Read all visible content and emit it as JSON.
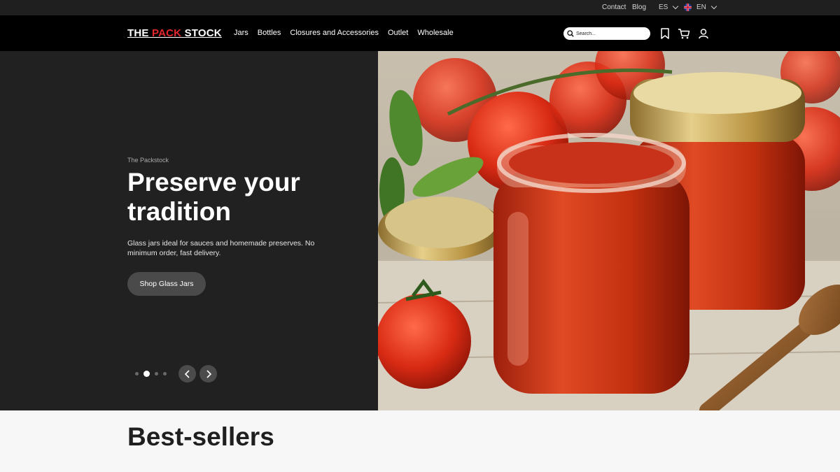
{
  "topbar": {
    "contact": "Contact",
    "blog": "Blog",
    "lang_es": "ES",
    "lang_en": "EN"
  },
  "header": {
    "logo_part1": "THE",
    "logo_part2": "PACK",
    "logo_part3": "STOCK",
    "nav": [
      "Jars",
      "Bottles",
      "Closures and Accessories",
      "Outlet",
      "Wholesale"
    ],
    "search_placeholder": "Search...",
    "icons": [
      "search-icon",
      "bookmark-icon",
      "cart-icon",
      "user-icon"
    ]
  },
  "hero": {
    "eyebrow": "The Packstock",
    "headline": "Preserve your tradition",
    "description": "Glass jars ideal for sauces and homemade preserves. No minimum order, fast delivery.",
    "cta_label": "Shop Glass Jars",
    "slides_total": 4,
    "active_slide": 2
  },
  "sections": {
    "bestsellers_title": "Best-sellers"
  },
  "colors": {
    "accent_red": "#e3262b",
    "hero_bg": "#212121",
    "header_bg": "#000000"
  }
}
